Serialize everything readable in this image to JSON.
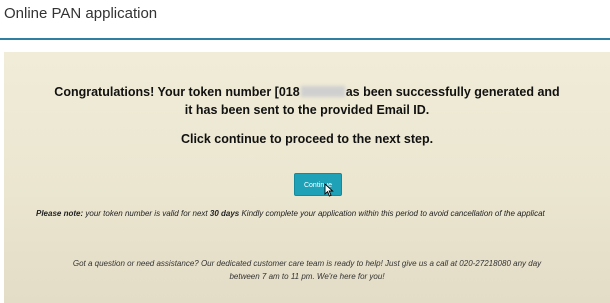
{
  "header": {
    "title": "Online PAN application"
  },
  "message": {
    "line1_prefix": "Congratulations! Your token number [018",
    "line1_suffix": "as been successfully generated and",
    "line2": "it has been sent to the provided Email ID.",
    "line3": "Click continue to proceed to the next step."
  },
  "continue_button": {
    "label": "Continue"
  },
  "note": {
    "label": "Please note:",
    "text_before": " your token number is valid for next ",
    "days": "30 days",
    "text_after": " Kindly complete your application within this period to avoid cancellation of the applicat"
  },
  "assistance": {
    "line1": "Got a question or need assistance? Our dedicated customer care team is ready to help! Just give us a call at 020-27218080 any day",
    "line2": "between 7 am to 11 pm. We're here for you!"
  },
  "colors": {
    "accent": "#1fa2b8",
    "rule": "#2e7fa0",
    "panel": "#ece7d2"
  }
}
